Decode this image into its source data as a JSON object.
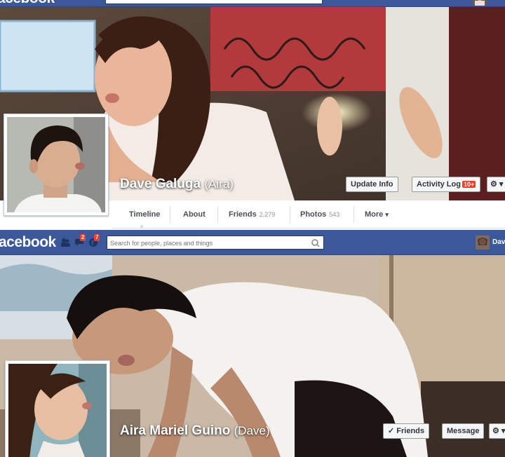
{
  "top": {
    "header": {
      "logo": "acebook"
    },
    "profile": {
      "name": "Dave Galuga",
      "alt_name": "(Aira)"
    },
    "buttons": {
      "update_info": "Update Info",
      "activity_log": "Activity Log",
      "activity_badge": "10+",
      "gear": "⚙ ▾"
    },
    "tabs": [
      {
        "label": "Timeline",
        "count": ""
      },
      {
        "label": "About",
        "count": ""
      },
      {
        "label": "Friends",
        "count": "2,279"
      },
      {
        "label": "Photos",
        "count": "543"
      },
      {
        "label": "More",
        "count": ""
      }
    ],
    "more_caret": "▾"
  },
  "bottom": {
    "header": {
      "logo": "acebook",
      "search_placeholder": "Search for people, places and things",
      "notif_badge_1": "2",
      "notif_badge_2": "7",
      "username": "Dav"
    },
    "profile": {
      "name": "Aira Mariel Guino",
      "alt_name": "(Dave)"
    },
    "buttons": {
      "friends": "✓ Friends",
      "message": "Message",
      "gear": "⚙ ▾"
    }
  },
  "colors": {
    "fb_blue": "#3b5998",
    "badge_red": "#f03d25"
  },
  "icons": [
    "friend-requests-icon",
    "messages-icon",
    "notifications-icon",
    "search-icon",
    "gear-icon"
  ]
}
